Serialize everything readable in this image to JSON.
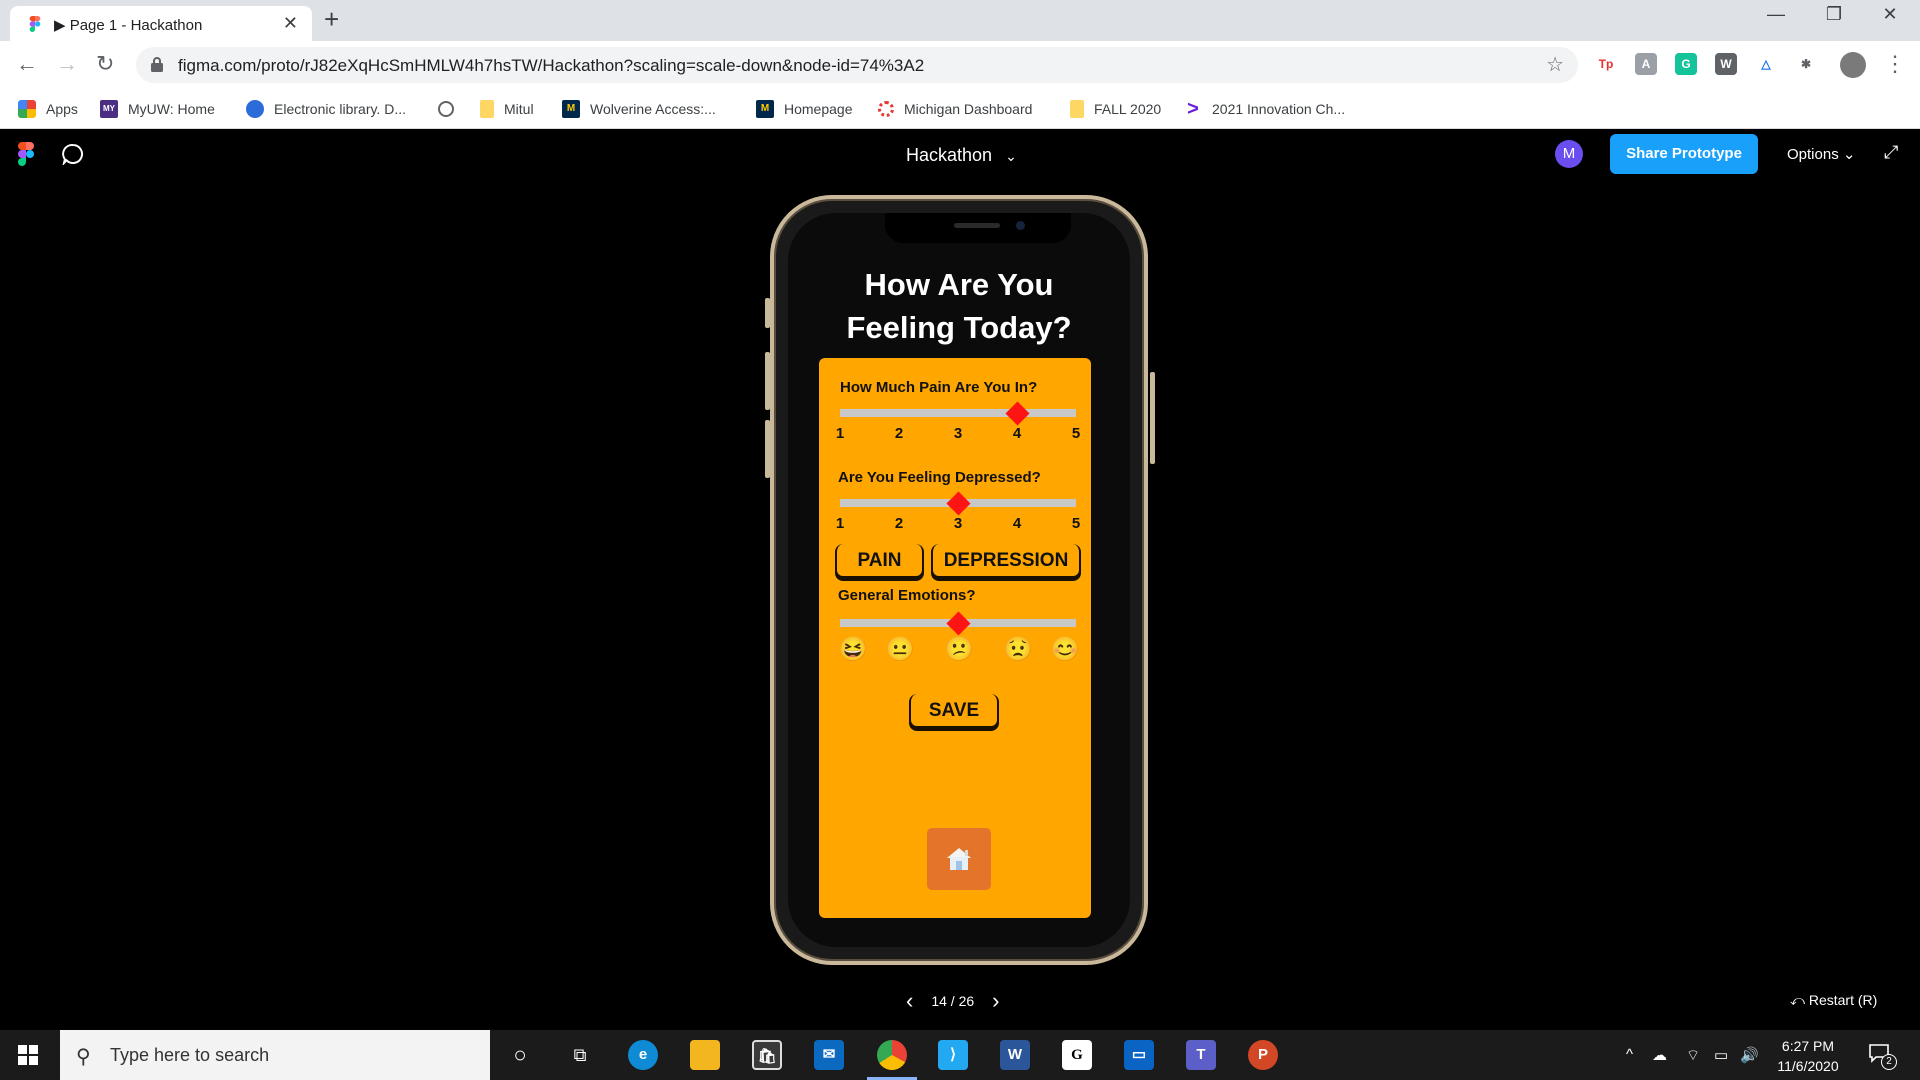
{
  "browser": {
    "tab_title": "▶ Page 1 - Hackathon",
    "tab_close": "✕",
    "new_tab": "+",
    "window_minimize": "—",
    "window_restore": "❐",
    "window_close": "✕",
    "url": "figma.com/proto/rJ82eXqHcSmHMLW4h7hsTW/Hackathon?scaling=scale-down&node-id=74%3A2",
    "star_icon": "☆",
    "extensions": [
      {
        "label": "Tp",
        "color": "#ffffff",
        "text_color": "#e8312f"
      },
      {
        "label": "A",
        "color": "#9aa0a6",
        "text_color": "#ffffff"
      },
      {
        "label": "G",
        "color": "#15c39a",
        "text_color": "#ffffff"
      },
      {
        "label": "W",
        "color": "#5f6368",
        "text_color": "#ffffff"
      },
      {
        "label": "△",
        "color": "#ffffff",
        "text_color": "#1a73e8"
      },
      {
        "label": "✱",
        "color": "#ffffff",
        "text_color": "#5f6368"
      }
    ]
  },
  "bookmarks": [
    {
      "label": "Apps",
      "icon": "apps-grid-icon"
    },
    {
      "label": "MyUW: Home",
      "icon": "myuw-icon"
    },
    {
      "label": "Electronic library. D...",
      "icon": "globe-blue-icon"
    },
    {
      "label": "",
      "icon": "globe-icon"
    },
    {
      "label": "Mitul",
      "icon": "folder-icon"
    },
    {
      "label": "Wolverine Access:...",
      "icon": "block-m-icon"
    },
    {
      "label": "Homepage",
      "icon": "block-m-icon"
    },
    {
      "label": "Michigan Dashboard",
      "icon": "dashboard-icon"
    },
    {
      "label": "FALL 2020",
      "icon": "folder-icon"
    },
    {
      "label": "2021 Innovation Ch...",
      "icon": "chevron-purple-icon"
    }
  ],
  "figma": {
    "file_title": "Hackathon",
    "title_caret": "⌄",
    "avatar_initial": "M",
    "share_label": "Share Prototype",
    "options_label": "Options ⌄",
    "expand_icon": "⤢"
  },
  "app": {
    "heading_line1": "How Are You",
    "heading_line2": "Feeling Today?",
    "pain_question": "How Much Pain Are You In?",
    "pain_value": 4,
    "depression_question": "Are You Feeling Depressed?",
    "depression_value": 3,
    "scale_labels": [
      "1",
      "2",
      "3",
      "4",
      "5"
    ],
    "pain_button": "PAIN",
    "depression_button": "DEPRESSION",
    "emotions_question": "General Emotions?",
    "emotions_value": 3,
    "emotion_faces": [
      "😆",
      "😐",
      "😕",
      "😟",
      "😊"
    ],
    "save_label": "SAVE",
    "colors": {
      "card": "#ffa600",
      "thumb": "#ff1414",
      "track": "#c8c8c8",
      "home": "#e4742a"
    }
  },
  "prototype": {
    "prev_icon": "‹",
    "page_counter": "14 / 26",
    "next_icon": "›",
    "restart_label": "⤺  Restart (R)"
  },
  "taskbar": {
    "search_placeholder": "Type here to search",
    "time": "6:27 PM",
    "date": "11/6/2020",
    "notification_count": "2"
  }
}
